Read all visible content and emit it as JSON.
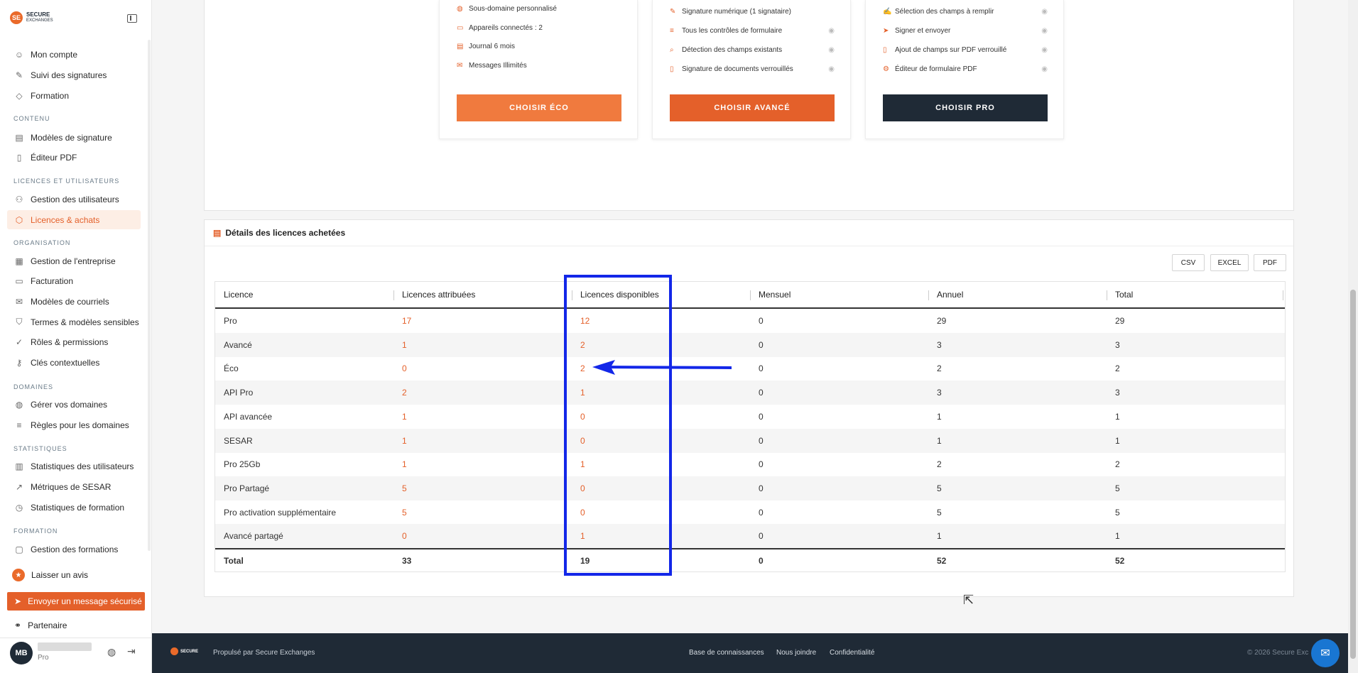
{
  "brand": {
    "line1": "SECURE",
    "line2": "EXCHANGES"
  },
  "sidebar": {
    "items": [
      {
        "label": "Mon compte",
        "icon": "user-icon"
      },
      {
        "label": "Suivi des signatures",
        "icon": "pen-icon"
      },
      {
        "label": "Formation",
        "icon": "graduation-cap-icon"
      },
      {
        "label": "Modèles de signature",
        "icon": "document-pen-icon"
      },
      {
        "label": "Éditeur PDF",
        "icon": "pdf-file-icon"
      },
      {
        "label": "Gestion des utilisateurs",
        "icon": "users-icon"
      },
      {
        "label": "Licences & achats",
        "icon": "box-icon"
      },
      {
        "label": "Gestion de l'entreprise",
        "icon": "building-icon"
      },
      {
        "label": "Facturation",
        "icon": "invoice-icon"
      },
      {
        "label": "Modèles de courriels",
        "icon": "mail-icon"
      },
      {
        "label": "Termes & modèles sensibles",
        "icon": "shield-icon"
      },
      {
        "label": "Rôles & permissions",
        "icon": "shield-check-icon"
      },
      {
        "label": "Clés contextuelles",
        "icon": "key-icon"
      },
      {
        "label": "Gérer vos domaines",
        "icon": "globe-icon"
      },
      {
        "label": "Règles pour les domaines",
        "icon": "sliders-icon"
      },
      {
        "label": "Statistiques des utilisateurs",
        "icon": "bar-chart-icon"
      },
      {
        "label": "Métriques de SESAR",
        "icon": "line-chart-icon"
      },
      {
        "label": "Statistiques de formation",
        "icon": "clock-icon"
      },
      {
        "label": "Gestion des formations",
        "icon": "presentation-icon"
      }
    ],
    "sections": {
      "contenu": "CONTENU",
      "licences": "LICENCES ET UTILISATEURS",
      "organisation": "ORGANISATION",
      "domaines": "DOMAINES",
      "statistiques": "STATISTIQUES",
      "formation": "FORMATION"
    },
    "review": "Laisser un avis",
    "secure_message": "Envoyer un message sécurisé",
    "partner": "Partenaire",
    "user": {
      "initials": "MB",
      "plan": "Pro"
    }
  },
  "plans": {
    "eco": {
      "features": [
        "Sous-domaine personnalisé",
        "Appareils connectés : 2",
        "Journal 6 mois",
        "Messages Illimités"
      ],
      "button": "CHOISIR ÉCO"
    },
    "avance": {
      "features": [
        "Signature numérique (1 signataire)",
        "Tous les contrôles de formulaire",
        "Détection des champs existants",
        "Signature de documents verrouillés"
      ],
      "button": "CHOISIR AVANCÉ"
    },
    "pro": {
      "features": [
        "Sélection des champs à remplir",
        "Signer et envoyer",
        "Ajout de champs sur PDF verrouillé",
        "Éditeur de formulaire PDF"
      ],
      "button": "CHOISIR PRO"
    }
  },
  "details": {
    "title": "Détails des licences achetées",
    "export": {
      "csv": "CSV",
      "excel": "EXCEL",
      "pdf": "PDF"
    },
    "headers": [
      "Licence",
      "Licences attribuées",
      "Licences disponibles",
      "Mensuel",
      "Annuel",
      "Total"
    ],
    "rows": [
      [
        "Pro",
        "17",
        "12",
        "0",
        "29",
        "29"
      ],
      [
        "Avancé",
        "1",
        "2",
        "0",
        "3",
        "3"
      ],
      [
        "Éco",
        "0",
        "2",
        "0",
        "2",
        "2"
      ],
      [
        "API Pro",
        "2",
        "1",
        "0",
        "3",
        "3"
      ],
      [
        "API avancée",
        "1",
        "0",
        "0",
        "1",
        "1"
      ],
      [
        "SESAR",
        "1",
        "0",
        "0",
        "1",
        "1"
      ],
      [
        "Pro 25Gb",
        "1",
        "1",
        "0",
        "2",
        "2"
      ],
      [
        "Pro Partagé",
        "5",
        "0",
        "0",
        "5",
        "5"
      ],
      [
        "Pro activation supplémentaire",
        "5",
        "0",
        "0",
        "5",
        "5"
      ],
      [
        "Avancé partagé",
        "0",
        "1",
        "0",
        "1",
        "1"
      ]
    ],
    "total": [
      "Total",
      "33",
      "19",
      "0",
      "52",
      "52"
    ]
  },
  "footer": {
    "powered": "Propulsé par Secure Exchanges",
    "links": [
      "Base de connaissances",
      "Nous joindre",
      "Confidentialité"
    ],
    "copyright": "© 2026 Secure Exc"
  },
  "colors": {
    "accent": "#e4602a",
    "dark": "#1f2a36",
    "highlight": "#1327e8",
    "chat": "#1976d2"
  }
}
